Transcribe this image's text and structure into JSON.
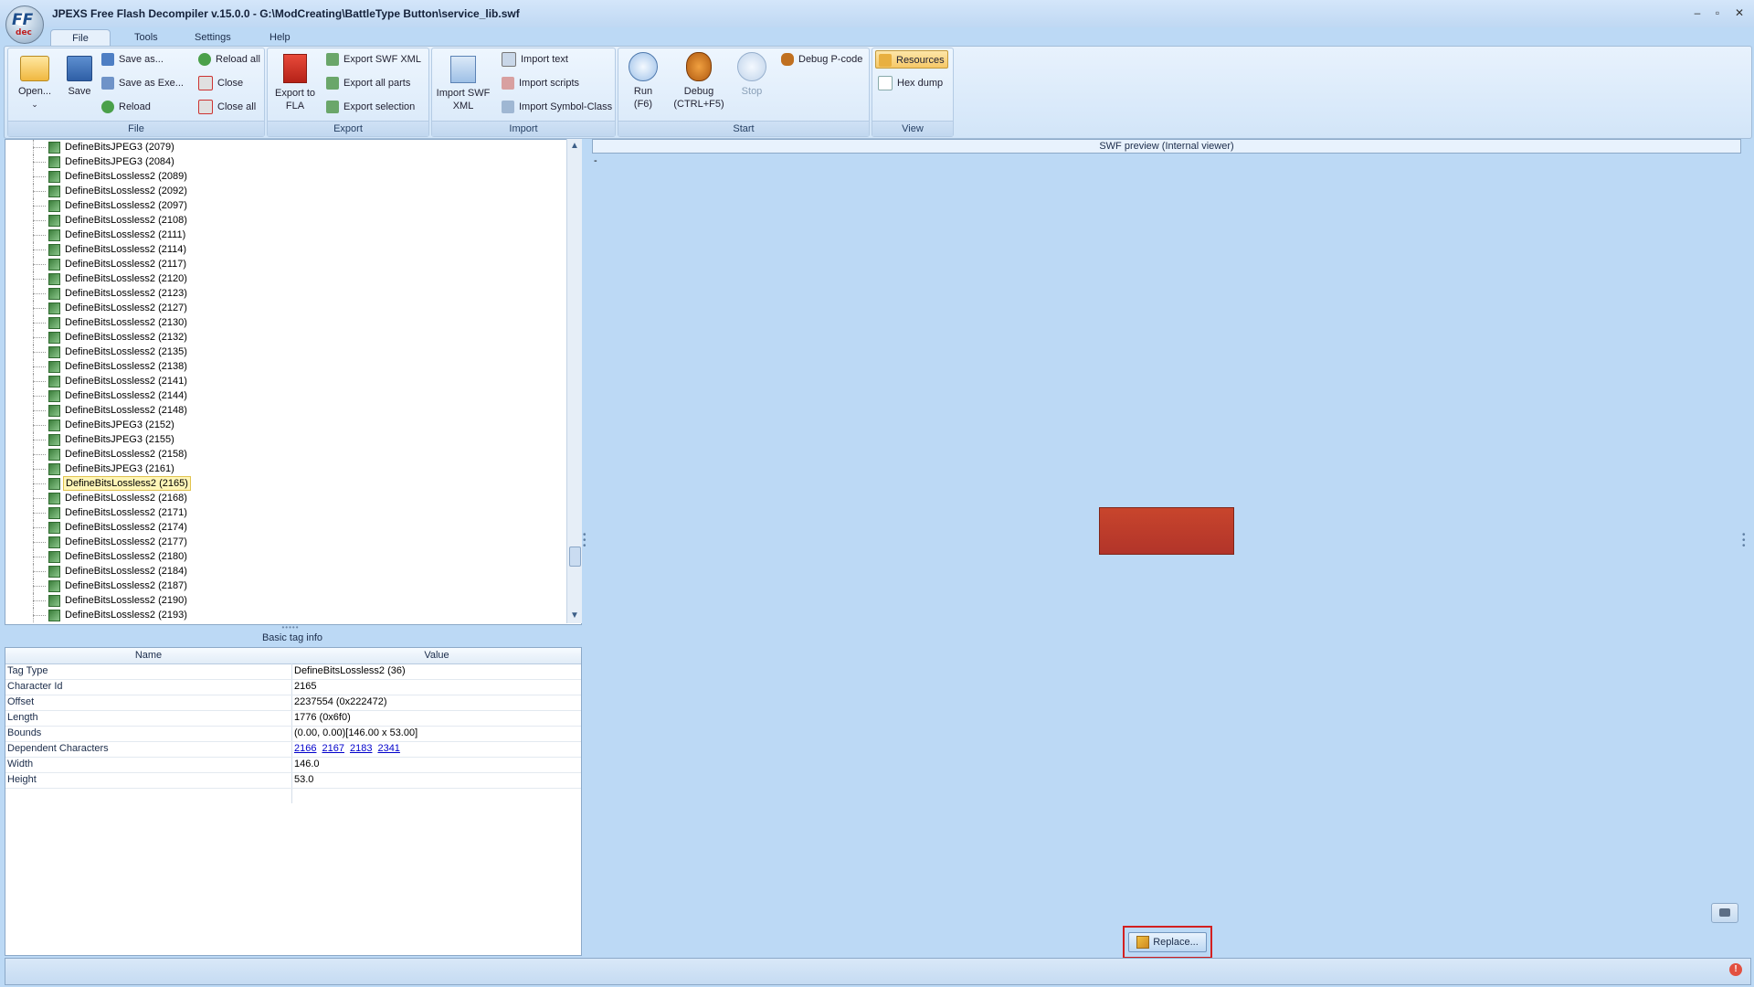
{
  "window": {
    "title": "JPEXS Free Flash Decompiler v.15.0.0 - G:\\ModCreating\\BattleType Button\\service_lib.swf",
    "logo_text": "FF",
    "logo_sub": "dec",
    "minimize": "–",
    "restore": "▫",
    "close": "✕"
  },
  "menu_tabs": [
    "File",
    "Tools",
    "Settings",
    "Help"
  ],
  "ribbon": {
    "file": {
      "label": "File",
      "open": "Open...",
      "save": "Save",
      "save_as": "Save as...",
      "save_as_exe": "Save as Exe...",
      "reload": "Reload",
      "reload_all": "Reload all",
      "close": "Close",
      "close_all": "Close all"
    },
    "export": {
      "label": "Export",
      "export_fla": "Export to FLA",
      "export_swf_xml": "Export SWF XML",
      "export_all_parts": "Export all parts",
      "export_selection": "Export selection"
    },
    "import": {
      "label": "Import",
      "import_swf_xml": "Import SWF XML",
      "import_text": "Import text",
      "import_scripts": "Import scripts",
      "import_symbol_class": "Import Symbol-Class"
    },
    "start": {
      "label": "Start",
      "run": "Run",
      "run_key": "(F6)",
      "debug": "Debug",
      "debug_key": "(CTRL+F5)",
      "stop": "Stop",
      "debug_pcode": "Debug P-code"
    },
    "view": {
      "label": "View",
      "resources": "Resources",
      "hex_dump": "Hex dump"
    }
  },
  "tree": {
    "items": [
      "DefineBitsJPEG3 (2079)",
      "DefineBitsJPEG3 (2084)",
      "DefineBitsLossless2 (2089)",
      "DefineBitsLossless2 (2092)",
      "DefineBitsLossless2 (2097)",
      "DefineBitsLossless2 (2108)",
      "DefineBitsLossless2 (2111)",
      "DefineBitsLossless2 (2114)",
      "DefineBitsLossless2 (2117)",
      "DefineBitsLossless2 (2120)",
      "DefineBitsLossless2 (2123)",
      "DefineBitsLossless2 (2127)",
      "DefineBitsLossless2 (2130)",
      "DefineBitsLossless2 (2132)",
      "DefineBitsLossless2 (2135)",
      "DefineBitsLossless2 (2138)",
      "DefineBitsLossless2 (2141)",
      "DefineBitsLossless2 (2144)",
      "DefineBitsLossless2 (2148)",
      "DefineBitsJPEG3 (2152)",
      "DefineBitsJPEG3 (2155)",
      "DefineBitsLossless2 (2158)",
      "DefineBitsJPEG3 (2161)",
      "DefineBitsLossless2 (2165)",
      "DefineBitsLossless2 (2168)",
      "DefineBitsLossless2 (2171)",
      "DefineBitsLossless2 (2174)",
      "DefineBitsLossless2 (2177)",
      "DefineBitsLossless2 (2180)",
      "DefineBitsLossless2 (2184)",
      "DefineBitsLossless2 (2187)",
      "DefineBitsLossless2 (2190)",
      "DefineBitsLossless2 (2193)"
    ],
    "selected": "DefineBitsLossless2 (2165)"
  },
  "basic_tag_info": {
    "title": "Basic tag info",
    "col_name": "Name",
    "col_value": "Value",
    "rows": [
      {
        "name": "Tag Type",
        "value": "DefineBitsLossless2 (36)"
      },
      {
        "name": "Character Id",
        "value": "2165"
      },
      {
        "name": "Offset",
        "value": "2237554 (0x222472)"
      },
      {
        "name": "Length",
        "value": "1776 (0x6f0)"
      },
      {
        "name": "Bounds",
        "value": "(0.00, 0.00)[146.00 x 53.00]"
      },
      {
        "name": "Dependent Characters",
        "links": [
          "2166",
          "2167",
          "2183",
          "2341"
        ]
      },
      {
        "name": "Width",
        "value": "146.0"
      },
      {
        "name": "Height",
        "value": "53.0"
      }
    ]
  },
  "preview": {
    "header": "SWF preview (Internal viewer)",
    "dash": "-",
    "replace_label": "Replace...",
    "button_color": "#c8452c"
  },
  "status": {
    "error_icon": "!"
  }
}
